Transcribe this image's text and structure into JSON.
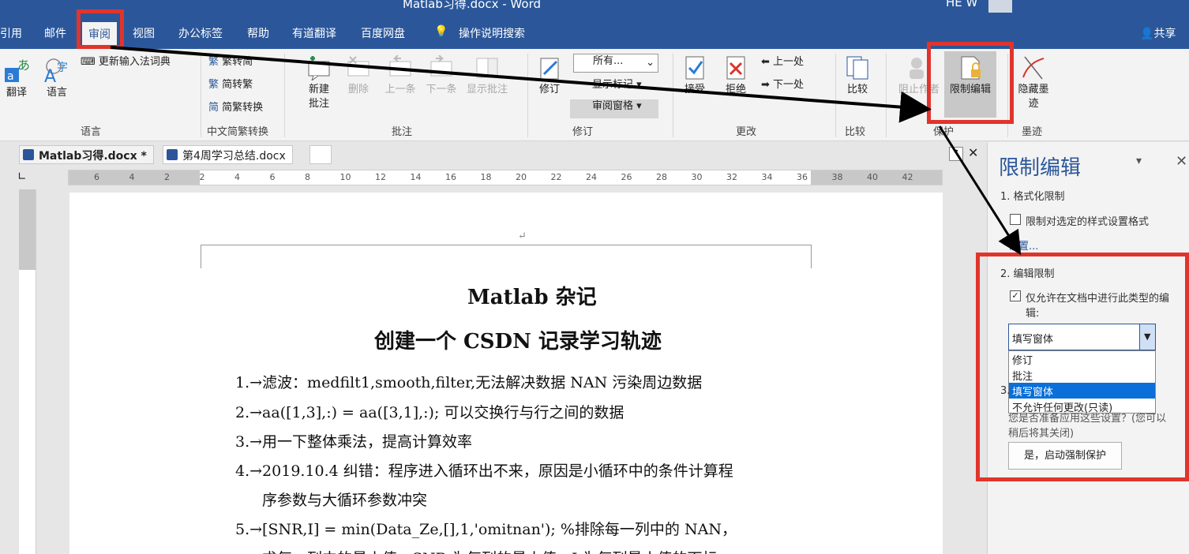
{
  "title_bar": {
    "doc_title": "Matlab习得.docx  -  Word",
    "user": "HE W"
  },
  "ribbon_tabs": [
    "引用",
    "邮件",
    "审阅",
    "视图",
    "办公标签",
    "帮助",
    "有道翻译",
    "百度网盘",
    "操作说明搜索"
  ],
  "share": "共享",
  "ribbon": {
    "language": {
      "translate": "翻译",
      "language": "语言",
      "update_ime": "更新输入法词典",
      "label": "语言"
    },
    "chinese": {
      "trad": "繁转简",
      "simp": "简转繁",
      "convert": "简繁转换",
      "label": "中文简繁转换"
    },
    "comments": {
      "new": "新建\n批注",
      "delete": "删除",
      "prev": "上一条",
      "next": "下一条",
      "show": "显示批注",
      "label": "批注"
    },
    "tracking": {
      "track": "修订",
      "all_markup": "所有...",
      "show_markup": "显示标记",
      "review_pane": "审阅窗格",
      "label": "修订"
    },
    "changes": {
      "accept": "接受",
      "reject": "拒绝",
      "prev": "上一处",
      "next": "下一处",
      "label": "更改"
    },
    "compare": {
      "compare": "比较",
      "label": "比较"
    },
    "protect": {
      "block": "阻止作者",
      "restrict": "限制编辑",
      "label": "保护"
    },
    "ink": {
      "hide_ink": "隐藏墨\n迹",
      "label": "墨迹"
    }
  },
  "doc_tabs": [
    "Matlab习得.docx *",
    "第4周学习总结.docx"
  ],
  "ruler_numbers": [
    "6",
    "4",
    "2",
    "2",
    "4",
    "6",
    "8",
    "10",
    "12",
    "14",
    "16",
    "18",
    "20",
    "22",
    "24",
    "26",
    "28",
    "30",
    "32",
    "34",
    "36",
    "38",
    "40",
    "42"
  ],
  "document": {
    "heading1": "Matlab 杂记",
    "heading2": "创建一个 CSDN 记录学习轨迹",
    "lines": [
      "1.→滤波：medfilt1,smooth,filter,无法解决数据 NAN 污染周边数据",
      "2.→aa([1,3],:) = aa([3,1],:);  可以交换行与行之间的数据",
      "3.→用一下整体乘法，提高计算效率",
      "4.→2019.10.4 纠错：程序进入循环出不来，原因是小循环中的条件计算程",
      "序参数与大循环参数冲突",
      "5.→[SNR,I] = min(Data_Ze,[],1,'omitnan');        %排除每一列中的 NAN，",
      "求每一列中的最小值，SNR 为每列的最小值，I 为每列最小值的下标"
    ]
  },
  "pane": {
    "title": "限制编辑",
    "sec1": "1. 格式化限制",
    "sec1_check": "限制对选定的样式设置格式",
    "settings_link": "设置...",
    "sec2": "2. 编辑限制",
    "sec2_check": "仅允许在文档中进行此类型的编",
    "sec2_check2": "辑:",
    "dropdown_value": "填写窗体",
    "options": [
      "修订",
      "批注",
      "填写窗体",
      "不允许任何更改(只读)"
    ],
    "sec3": "3.",
    "sec3_text1": "您是否准备应用这些设置？(您可以",
    "sec3_text2": "稍后将其关闭)",
    "start_button": "是，启动强制保护"
  }
}
